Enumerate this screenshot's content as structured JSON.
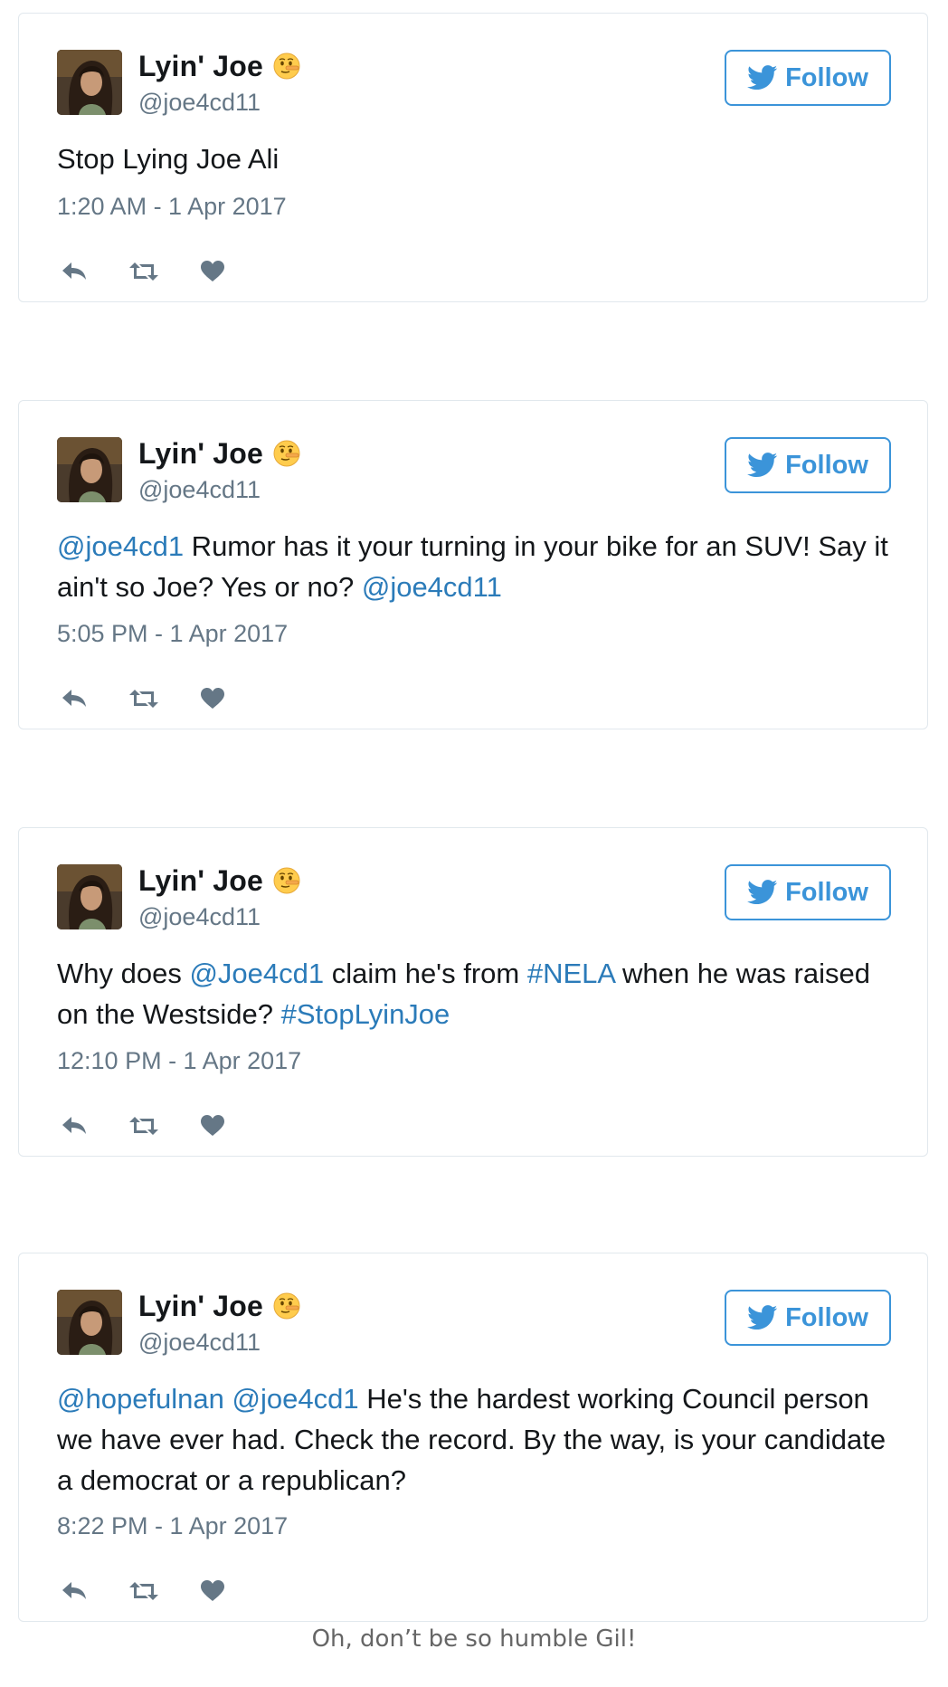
{
  "user": {
    "display_name": "Lyin' Joe",
    "handle": "@joe4cd11",
    "emoji_icon": "lying-face-emoji"
  },
  "follow_label": "Follow",
  "colors": {
    "link": "#2b7bb9",
    "follow_accent": "#3b94d9",
    "muted": "#657786",
    "border": "#e1e8ed"
  },
  "tweets": [
    {
      "segments": [
        {
          "type": "text",
          "value": "Stop Lying Joe Ali"
        }
      ],
      "timestamp": "1:20 AM - 1 Apr 2017"
    },
    {
      "segments": [
        {
          "type": "link",
          "value": "@joe4cd1"
        },
        {
          "type": "text",
          "value": " Rumor has it your turning in your bike for an SUV! Say it ain't so Joe? Yes or no? "
        },
        {
          "type": "link",
          "value": "@joe4cd11"
        }
      ],
      "timestamp": "5:05 PM - 1 Apr 2017"
    },
    {
      "segments": [
        {
          "type": "text",
          "value": "Why does "
        },
        {
          "type": "link",
          "value": "@Joe4cd1"
        },
        {
          "type": "text",
          "value": " claim he's from "
        },
        {
          "type": "link",
          "value": "#NELA"
        },
        {
          "type": "text",
          "value": " when he was raised on the Westside? "
        },
        {
          "type": "link",
          "value": "#StopLyinJoe"
        }
      ],
      "timestamp": "12:10 PM - 1 Apr 2017"
    },
    {
      "segments": [
        {
          "type": "link",
          "value": "@hopefulnan"
        },
        {
          "type": "text",
          "value": " "
        },
        {
          "type": "link",
          "value": "@joe4cd1"
        },
        {
          "type": "text",
          "value": " He's the hardest working Council person we have ever had. Check the record. By the way, is your candidate a democrat or a republican?"
        }
      ],
      "timestamp": "8:22 PM - 1 Apr 2017"
    }
  ],
  "action_icons": [
    "reply-icon",
    "retweet-icon",
    "like-icon"
  ],
  "caption": "Oh, don’t be so humble Gil!"
}
